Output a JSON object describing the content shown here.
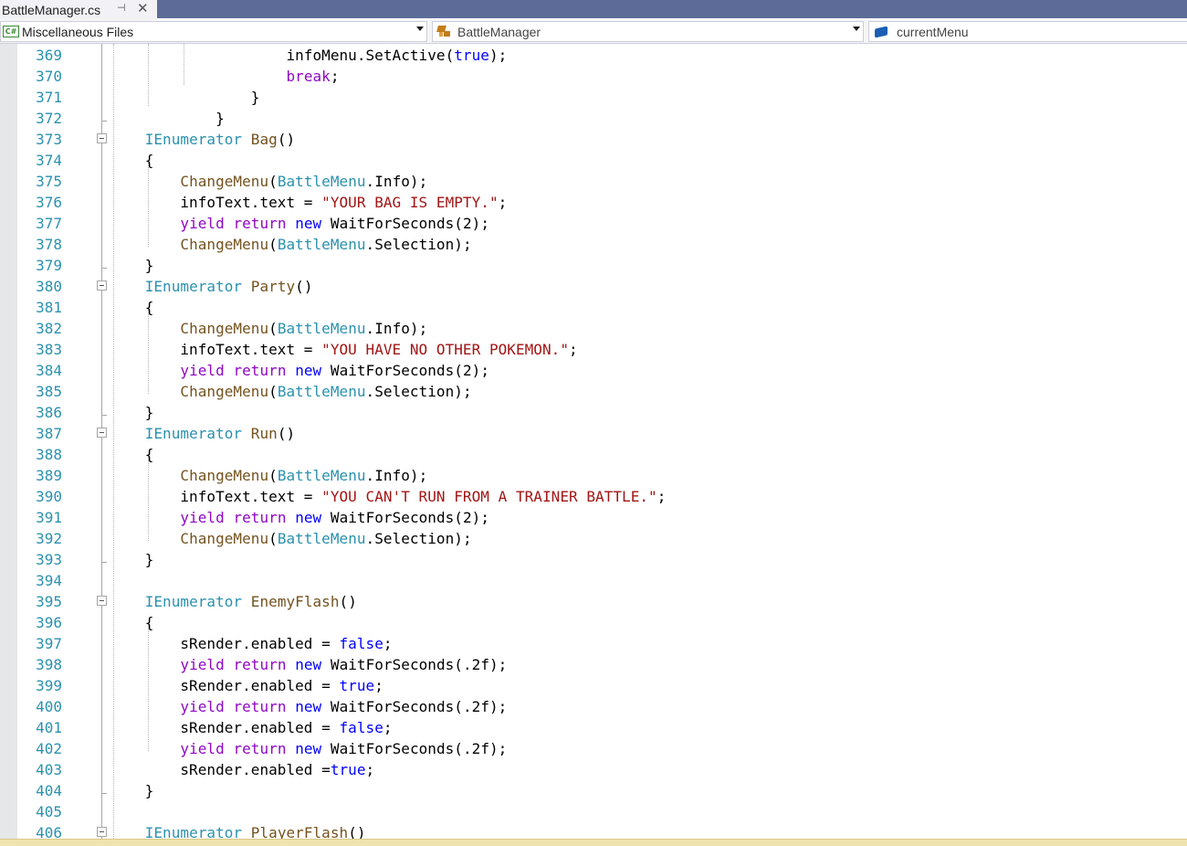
{
  "tab": {
    "title": "BattleManager.cs",
    "pin_glyph": "⊣",
    "close_glyph": "✕"
  },
  "navbar": {
    "project": "Miscellaneous Files",
    "project_icon": "C#",
    "type": "BattleManager",
    "member": "currentMenu"
  },
  "icons": {
    "project": "csharp-file-icon",
    "type": "class-icon",
    "member": "field-icon"
  },
  "colors": {
    "tabbar": "#5d6b99",
    "line_number": "#2b91af",
    "keyword": "#0000ff",
    "control_keyword": "#8f08c4",
    "type": "#2b91af",
    "method": "#74531f",
    "string": "#a31515"
  },
  "editor": {
    "lines": [
      {
        "n": "369",
        "fold": false,
        "tokens": [
          [
            "p",
            "                    infoMenu.SetActive("
          ],
          [
            "kw",
            "true"
          ],
          [
            "p",
            ");"
          ]
        ]
      },
      {
        "n": "370",
        "fold": false,
        "tokens": [
          [
            "p",
            "                    "
          ],
          [
            "kwc",
            "break"
          ],
          [
            "p",
            ";"
          ]
        ]
      },
      {
        "n": "371",
        "fold": false,
        "tokens": [
          [
            "p",
            "                }"
          ]
        ]
      },
      {
        "n": "372",
        "fold": false,
        "tick": true,
        "tokens": [
          [
            "p",
            "            }"
          ]
        ]
      },
      {
        "n": "373",
        "fold": true,
        "tokens": [
          [
            "p",
            "    "
          ],
          [
            "ty",
            "IEnumerator"
          ],
          [
            "p",
            " "
          ],
          [
            "fn",
            "Bag"
          ],
          [
            "p",
            "()"
          ]
        ]
      },
      {
        "n": "374",
        "fold": false,
        "tokens": [
          [
            "p",
            "    {"
          ]
        ]
      },
      {
        "n": "375",
        "fold": false,
        "tokens": [
          [
            "p",
            "        "
          ],
          [
            "fn",
            "ChangeMenu"
          ],
          [
            "p",
            "("
          ],
          [
            "ty",
            "BattleMenu"
          ],
          [
            "p",
            ".Info);"
          ]
        ]
      },
      {
        "n": "376",
        "fold": false,
        "tokens": [
          [
            "p",
            "        infoText.text = "
          ],
          [
            "str",
            "\"YOUR BAG IS EMPTY.\""
          ],
          [
            "p",
            ";"
          ]
        ]
      },
      {
        "n": "377",
        "fold": false,
        "tokens": [
          [
            "p",
            "        "
          ],
          [
            "kwc",
            "yield"
          ],
          [
            "p",
            " "
          ],
          [
            "kwc",
            "return"
          ],
          [
            "p",
            " "
          ],
          [
            "kw",
            "new"
          ],
          [
            "p",
            " WaitForSeconds(2);"
          ]
        ]
      },
      {
        "n": "378",
        "fold": false,
        "tokens": [
          [
            "p",
            "        "
          ],
          [
            "fn",
            "ChangeMenu"
          ],
          [
            "p",
            "("
          ],
          [
            "ty",
            "BattleMenu"
          ],
          [
            "p",
            ".Selection);"
          ]
        ]
      },
      {
        "n": "379",
        "fold": false,
        "tick": true,
        "tokens": [
          [
            "p",
            "    }"
          ]
        ]
      },
      {
        "n": "380",
        "fold": true,
        "tokens": [
          [
            "p",
            "    "
          ],
          [
            "ty",
            "IEnumerator"
          ],
          [
            "p",
            " "
          ],
          [
            "fn",
            "Party"
          ],
          [
            "p",
            "()"
          ]
        ]
      },
      {
        "n": "381",
        "fold": false,
        "tokens": [
          [
            "p",
            "    {"
          ]
        ]
      },
      {
        "n": "382",
        "fold": false,
        "tokens": [
          [
            "p",
            "        "
          ],
          [
            "fn",
            "ChangeMenu"
          ],
          [
            "p",
            "("
          ],
          [
            "ty",
            "BattleMenu"
          ],
          [
            "p",
            ".Info);"
          ]
        ]
      },
      {
        "n": "383",
        "fold": false,
        "tokens": [
          [
            "p",
            "        infoText.text = "
          ],
          [
            "str",
            "\"YOU HAVE NO OTHER POKEMON.\""
          ],
          [
            "p",
            ";"
          ]
        ]
      },
      {
        "n": "384",
        "fold": false,
        "tokens": [
          [
            "p",
            "        "
          ],
          [
            "kwc",
            "yield"
          ],
          [
            "p",
            " "
          ],
          [
            "kwc",
            "return"
          ],
          [
            "p",
            " "
          ],
          [
            "kw",
            "new"
          ],
          [
            "p",
            " WaitForSeconds(2);"
          ]
        ]
      },
      {
        "n": "385",
        "fold": false,
        "tokens": [
          [
            "p",
            "        "
          ],
          [
            "fn",
            "ChangeMenu"
          ],
          [
            "p",
            "("
          ],
          [
            "ty",
            "BattleMenu"
          ],
          [
            "p",
            ".Selection);"
          ]
        ]
      },
      {
        "n": "386",
        "fold": false,
        "tick": true,
        "tokens": [
          [
            "p",
            "    }"
          ]
        ]
      },
      {
        "n": "387",
        "fold": true,
        "tokens": [
          [
            "p",
            "    "
          ],
          [
            "ty",
            "IEnumerator"
          ],
          [
            "p",
            " "
          ],
          [
            "fn",
            "Run"
          ],
          [
            "p",
            "()"
          ]
        ]
      },
      {
        "n": "388",
        "fold": false,
        "tokens": [
          [
            "p",
            "    {"
          ]
        ]
      },
      {
        "n": "389",
        "fold": false,
        "tokens": [
          [
            "p",
            "        "
          ],
          [
            "fn",
            "ChangeMenu"
          ],
          [
            "p",
            "("
          ],
          [
            "ty",
            "BattleMenu"
          ],
          [
            "p",
            ".Info);"
          ]
        ]
      },
      {
        "n": "390",
        "fold": false,
        "tokens": [
          [
            "p",
            "        infoText.text = "
          ],
          [
            "str",
            "\"YOU CAN'T RUN FROM A TRAINER BATTLE.\""
          ],
          [
            "p",
            ";"
          ]
        ]
      },
      {
        "n": "391",
        "fold": false,
        "tokens": [
          [
            "p",
            "        "
          ],
          [
            "kwc",
            "yield"
          ],
          [
            "p",
            " "
          ],
          [
            "kwc",
            "return"
          ],
          [
            "p",
            " "
          ],
          [
            "kw",
            "new"
          ],
          [
            "p",
            " WaitForSeconds(2);"
          ]
        ]
      },
      {
        "n": "392",
        "fold": false,
        "tokens": [
          [
            "p",
            "        "
          ],
          [
            "fn",
            "ChangeMenu"
          ],
          [
            "p",
            "("
          ],
          [
            "ty",
            "BattleMenu"
          ],
          [
            "p",
            ".Selection);"
          ]
        ]
      },
      {
        "n": "393",
        "fold": false,
        "tick": true,
        "tokens": [
          [
            "p",
            "    }"
          ]
        ]
      },
      {
        "n": "394",
        "fold": false,
        "tokens": [
          [
            "p",
            ""
          ]
        ]
      },
      {
        "n": "395",
        "fold": true,
        "tokens": [
          [
            "p",
            "    "
          ],
          [
            "ty",
            "IEnumerator"
          ],
          [
            "p",
            " "
          ],
          [
            "fn",
            "EnemyFlash"
          ],
          [
            "p",
            "()"
          ]
        ]
      },
      {
        "n": "396",
        "fold": false,
        "tokens": [
          [
            "p",
            "    {"
          ]
        ]
      },
      {
        "n": "397",
        "fold": false,
        "tokens": [
          [
            "p",
            "        sRender.enabled = "
          ],
          [
            "kw",
            "false"
          ],
          [
            "p",
            ";"
          ]
        ]
      },
      {
        "n": "398",
        "fold": false,
        "tokens": [
          [
            "p",
            "        "
          ],
          [
            "kwc",
            "yield"
          ],
          [
            "p",
            " "
          ],
          [
            "kwc",
            "return"
          ],
          [
            "p",
            " "
          ],
          [
            "kw",
            "new"
          ],
          [
            "p",
            " WaitForSeconds(.2f);"
          ]
        ]
      },
      {
        "n": "399",
        "fold": false,
        "tokens": [
          [
            "p",
            "        sRender.enabled = "
          ],
          [
            "kw",
            "true"
          ],
          [
            "p",
            ";"
          ]
        ]
      },
      {
        "n": "400",
        "fold": false,
        "tokens": [
          [
            "p",
            "        "
          ],
          [
            "kwc",
            "yield"
          ],
          [
            "p",
            " "
          ],
          [
            "kwc",
            "return"
          ],
          [
            "p",
            " "
          ],
          [
            "kw",
            "new"
          ],
          [
            "p",
            " WaitForSeconds(.2f);"
          ]
        ]
      },
      {
        "n": "401",
        "fold": false,
        "tokens": [
          [
            "p",
            "        sRender.enabled = "
          ],
          [
            "kw",
            "false"
          ],
          [
            "p",
            ";"
          ]
        ]
      },
      {
        "n": "402",
        "fold": false,
        "tokens": [
          [
            "p",
            "        "
          ],
          [
            "kwc",
            "yield"
          ],
          [
            "p",
            " "
          ],
          [
            "kwc",
            "return"
          ],
          [
            "p",
            " "
          ],
          [
            "kw",
            "new"
          ],
          [
            "p",
            " WaitForSeconds(.2f);"
          ]
        ]
      },
      {
        "n": "403",
        "fold": false,
        "tokens": [
          [
            "p",
            "        sRender.enabled ="
          ],
          [
            "kw",
            "true"
          ],
          [
            "p",
            ";"
          ]
        ]
      },
      {
        "n": "404",
        "fold": false,
        "tick": true,
        "tokens": [
          [
            "p",
            "    }"
          ]
        ]
      },
      {
        "n": "405",
        "fold": false,
        "tokens": [
          [
            "p",
            ""
          ]
        ]
      },
      {
        "n": "406",
        "fold": true,
        "tokens": [
          [
            "p",
            "    "
          ],
          [
            "ty",
            "IEnumerator"
          ],
          [
            "p",
            " "
          ],
          [
            "fn",
            "PlayerFlash"
          ],
          [
            "p",
            "()"
          ]
        ]
      }
    ]
  }
}
